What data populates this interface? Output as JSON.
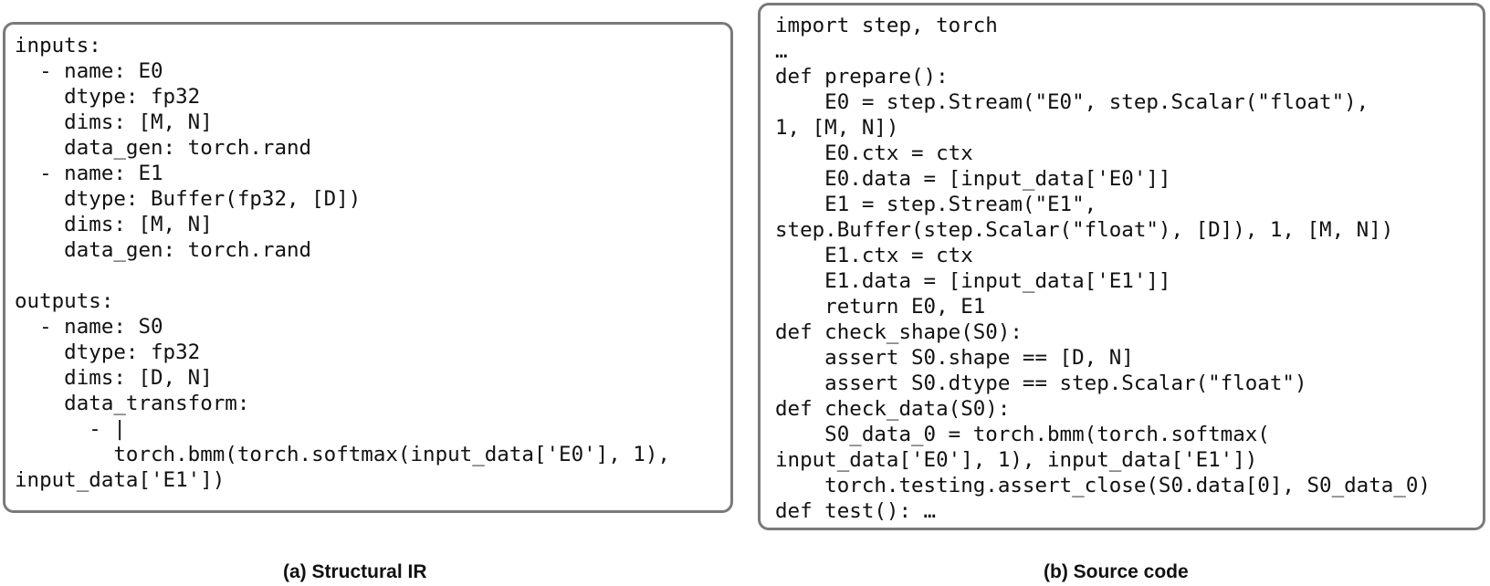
{
  "structural_ir": {
    "code": "inputs:\n  - name: E0\n    dtype: fp32\n    dims: [M, N]\n    data_gen: torch.rand\n  - name: E1\n    dtype: Buffer(fp32, [D])\n    dims: [M, N]\n    data_gen: torch.rand\n\noutputs:\n  - name: S0\n    dtype: fp32\n    dims: [D, N]\n    data_transform:\n      - |\n        torch.bmm(torch.softmax(input_data['E0'], 1),\ninput_data['E1'])",
    "caption": "(a) Structural IR"
  },
  "source_code": {
    "code": "import step, torch\n…\ndef prepare():\n    E0 = step.Stream(\"E0\", step.Scalar(\"float\"),\n1, [M, N])\n    E0.ctx = ctx\n    E0.data = [input_data['E0']]\n    E1 = step.Stream(\"E1\",\nstep.Buffer(step.Scalar(\"float\"), [D]), 1, [M, N])\n    E1.ctx = ctx\n    E1.data = [input_data['E1']]\n    return E0, E1\ndef check_shape(S0):\n    assert S0.shape == [D, N]\n    assert S0.dtype == step.Scalar(\"float\")\ndef check_data(S0):\n    S0_data_0 = torch.bmm(torch.softmax(\ninput_data['E0'], 1), input_data['E1'])\n    torch.testing.assert_close(S0.data[0], S0_data_0)\ndef test(): …",
    "caption": "(b) Source code"
  }
}
